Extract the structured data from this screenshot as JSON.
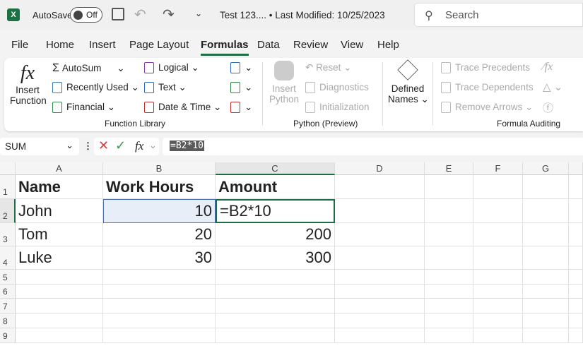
{
  "titlebar": {
    "autosave": "AutoSave",
    "toggle": "Off",
    "title": "Test 123.... • Last Modified: 10/25/2023",
    "search": "Search"
  },
  "tabs": [
    "File",
    "Home",
    "Insert",
    "Page Layout",
    "Formulas",
    "Data",
    "Review",
    "View",
    "Help"
  ],
  "ribbon": {
    "insert_function": [
      "Insert",
      "Function"
    ],
    "autosum": "AutoSum",
    "recently_used": "Recently Used",
    "financial": "Financial",
    "logical": "Logical",
    "text": "Text",
    "date_time": "Date & Time",
    "function_library": "Function Library",
    "insert_python": [
      "Insert",
      "Python"
    ],
    "reset": "Reset",
    "diagnostics": "Diagnostics",
    "initialization": "Initialization",
    "python_group": "Python (Preview)",
    "defined_names": [
      "Defined",
      "Names"
    ],
    "trace_precedents": "Trace Precedents",
    "trace_dependents": "Trace Dependents",
    "remove_arrows": "Remove Arrows",
    "formula_auditing": "Formula Auditing"
  },
  "formula_bar": {
    "name_box": "SUM",
    "fx": "fx",
    "formula": "=B2*10"
  },
  "sheet": {
    "columns": [
      "A",
      "B",
      "C",
      "D",
      "E",
      "F",
      "G"
    ],
    "rows": [
      "1",
      "2",
      "3",
      "4",
      "5",
      "6",
      "7",
      "8",
      "9"
    ],
    "cells": [
      [
        "Name",
        "Work Hours",
        "Amount"
      ],
      [
        "John",
        "10",
        "=B2*10"
      ],
      [
        "Tom",
        "20",
        "200"
      ],
      [
        "Luke",
        "30",
        "300"
      ]
    ]
  }
}
